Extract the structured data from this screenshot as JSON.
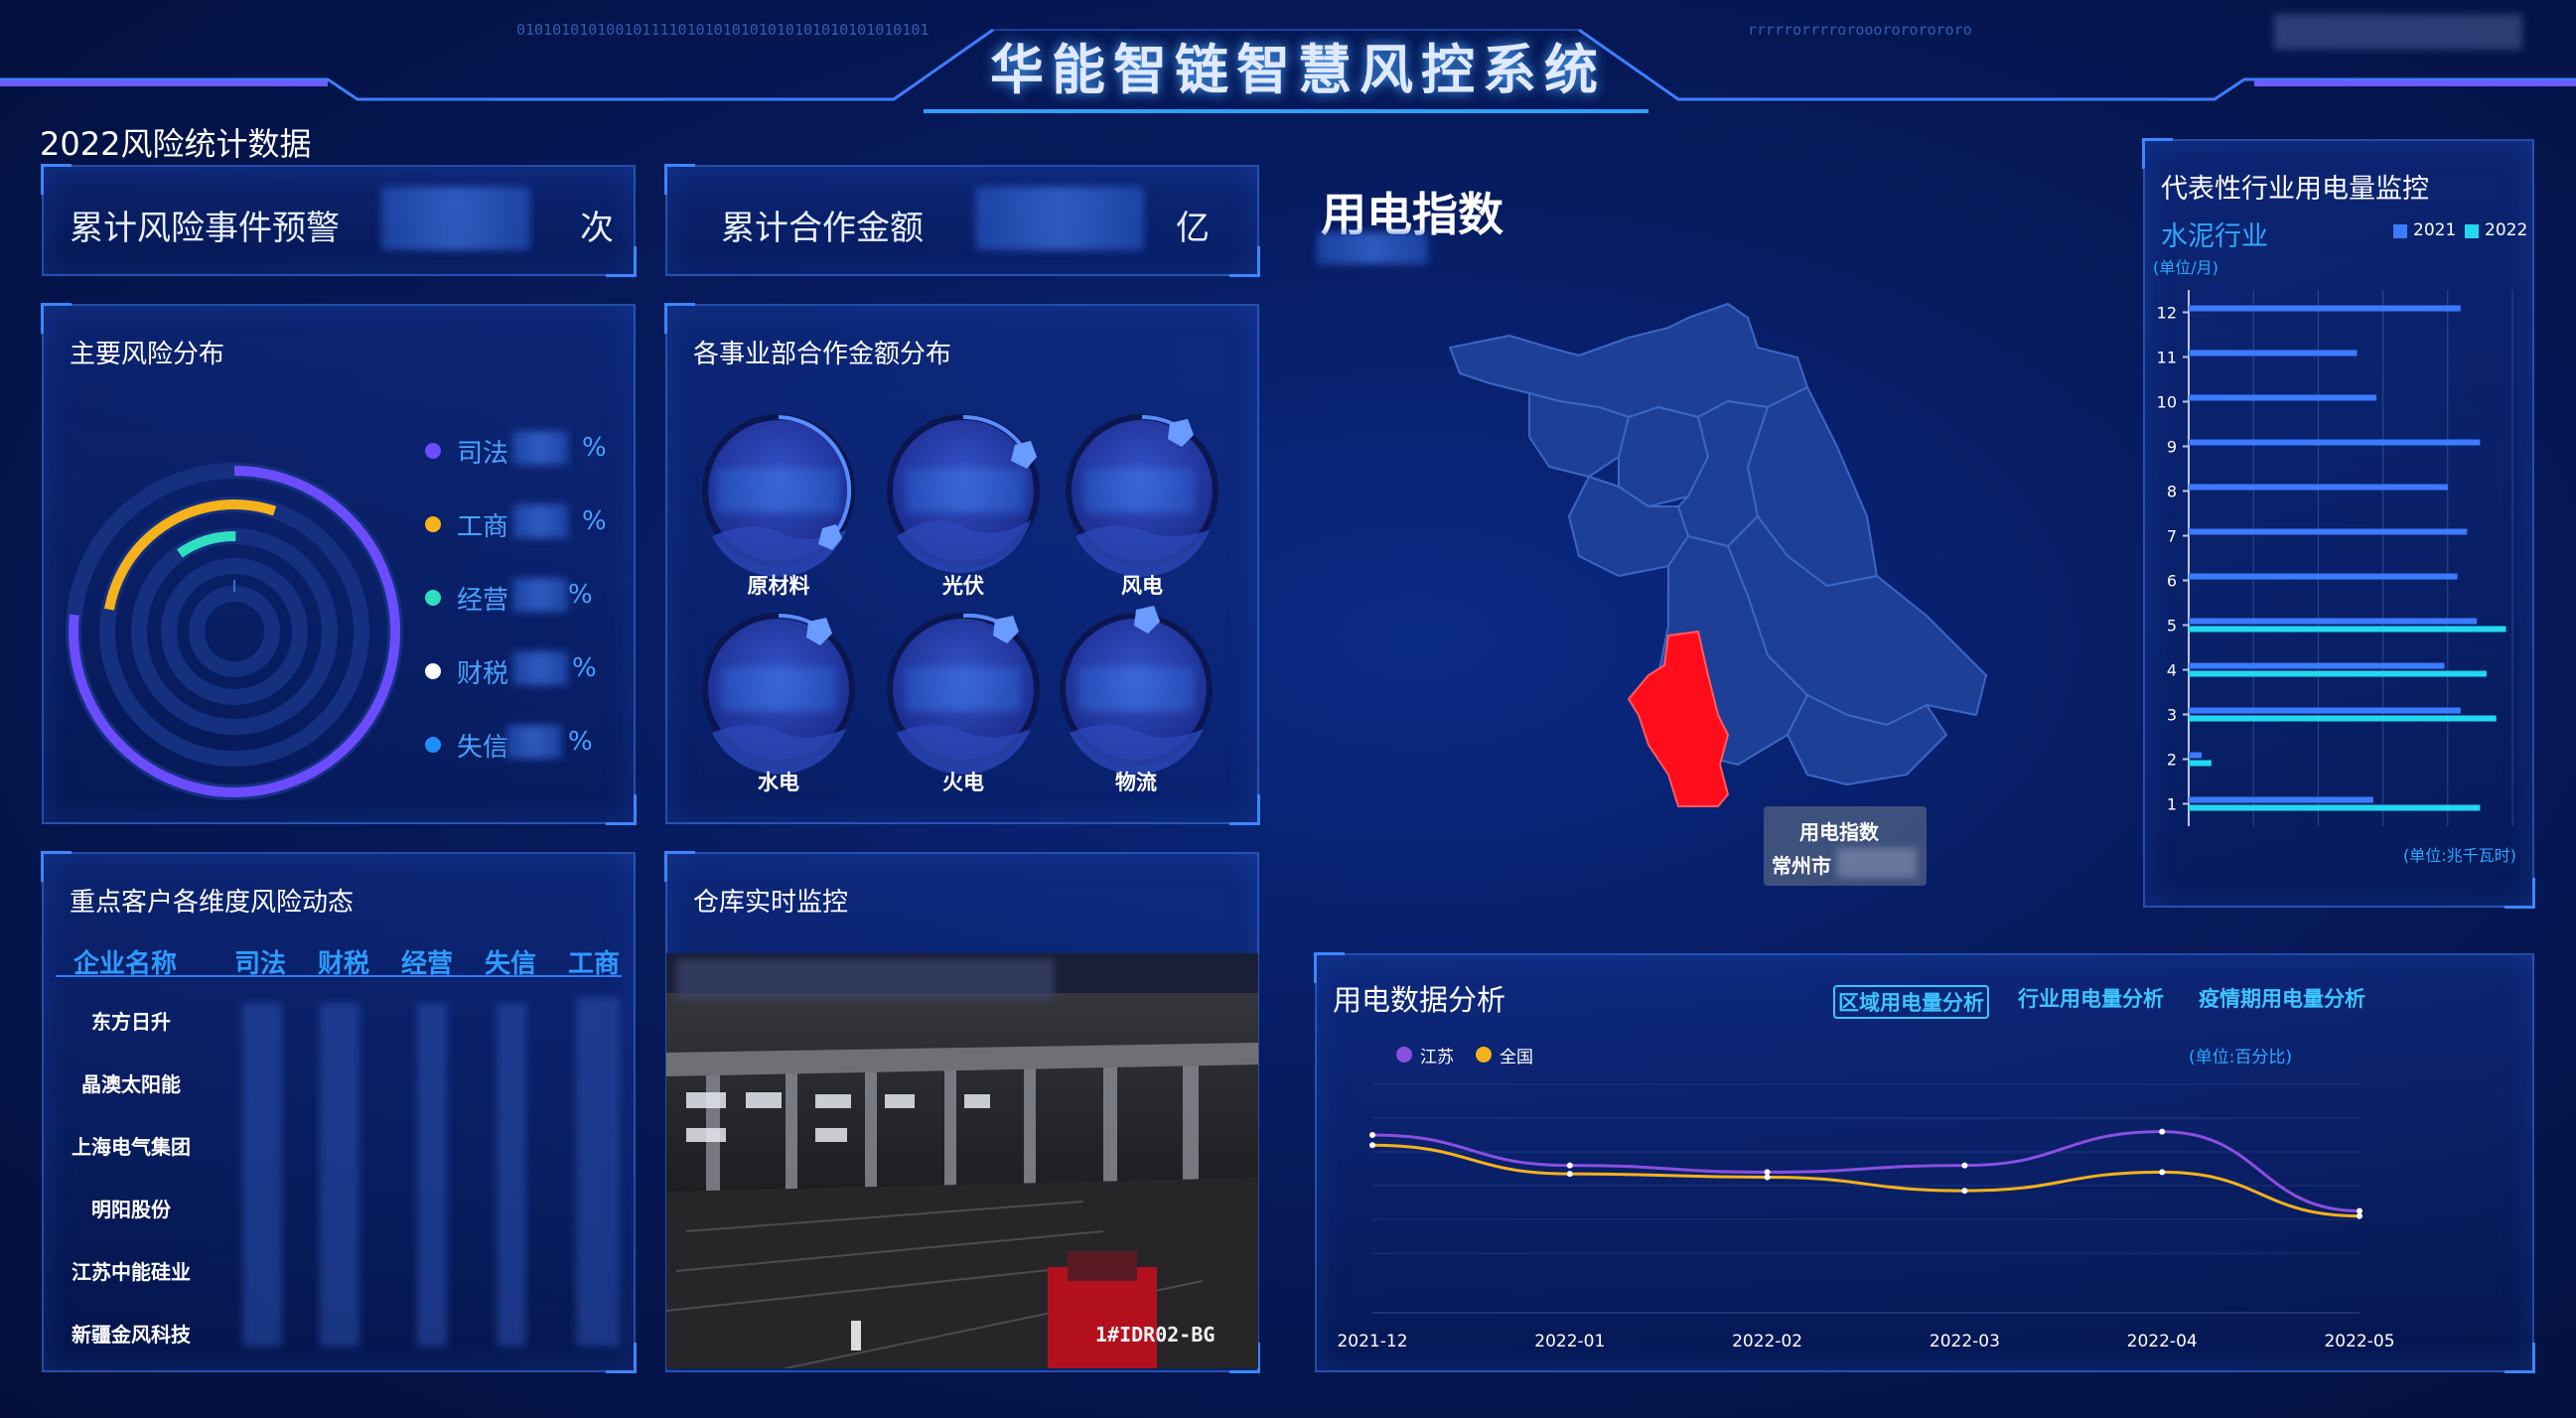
{
  "header": {
    "title": "华能智链智慧风控系统",
    "deco_binary_left": "0101010101001011110101010101010101010101010101",
    "deco_binary_right": "rrrrrorrrrorooorororororo"
  },
  "stats": {
    "section_title": "2022风险统计数据",
    "risk_events_label": "累计风险事件预警",
    "risk_events_unit": "次",
    "coop_amount_label": "累计合作金额",
    "coop_amount_unit": "亿"
  },
  "risk_distribution": {
    "title": "主要风险分布",
    "items": [
      {
        "label": "司法",
        "unit": "%",
        "color": "#6b4cff"
      },
      {
        "label": "工商",
        "unit": "%",
        "color": "#f5b21b"
      },
      {
        "label": "经营",
        "unit": "%",
        "color": "#2fe0c0"
      },
      {
        "label": "财税",
        "unit": "%",
        "color": "#ffffff"
      },
      {
        "label": "失信",
        "unit": "%",
        "color": "#1f8fff"
      }
    ]
  },
  "division_distribution": {
    "title": "各事业部合作金额分布",
    "bubbles": [
      "原材料",
      "光伏",
      "风电",
      "水电",
      "火电",
      "物流"
    ]
  },
  "customer_risk": {
    "title": "重点客户各维度风险动态",
    "columns": [
      "企业名称",
      "司法",
      "财税",
      "经营",
      "失信",
      "工商"
    ],
    "companies": [
      "东方日升",
      "晶澳太阳能",
      "上海电气集团",
      "明阳股份",
      "江苏中能硅业",
      "新疆金风科技"
    ]
  },
  "warehouse": {
    "title": "仓库实时监控",
    "camera_id": "1#IDR02-BG"
  },
  "power_index": {
    "title": "用电指数",
    "tooltip_title": "用电指数",
    "tooltip_city": "常州市"
  },
  "industry_monitor": {
    "title": "代表性行业用电量监控",
    "industry": "水泥行业",
    "unit_month": "(单位/月)",
    "unit_value": "(单位:兆千瓦时)",
    "legend": [
      {
        "name": "2021",
        "color": "#3b7bff"
      },
      {
        "name": "2022",
        "color": "#22d8f0"
      }
    ],
    "chart_data": {
      "type": "bar",
      "orientation": "horizontal",
      "categories": [
        "12",
        "11",
        "10",
        "9",
        "8",
        "7",
        "6",
        "5",
        "4",
        "3",
        "2",
        "1"
      ],
      "series": [
        {
          "name": "2021",
          "values": [
            84,
            52,
            58,
            90,
            80,
            86,
            83,
            89,
            79,
            84,
            4,
            57
          ]
        },
        {
          "name": "2022",
          "values": [
            null,
            null,
            null,
            null,
            null,
            null,
            null,
            98,
            92,
            95,
            7,
            90
          ]
        }
      ],
      "xlim": [
        0,
        100
      ]
    }
  },
  "power_analysis": {
    "title": "用电数据分析",
    "tabs": [
      "区域用电量分析",
      "行业用电量分析",
      "疫情期用电量分析"
    ],
    "unit": "(单位:百分比)",
    "legend": [
      {
        "name": "江苏",
        "color": "#8b4fe0"
      },
      {
        "name": "全国",
        "color": "#f5b21b"
      }
    ],
    "chart_data": {
      "type": "line",
      "x": [
        "2021-12",
        "2022-01",
        "2022-02",
        "2022-03",
        "2022-04",
        "2022-05"
      ],
      "series": [
        {
          "name": "江苏",
          "values": [
            70,
            52,
            48,
            52,
            72,
            25
          ]
        },
        {
          "name": "全国",
          "values": [
            64,
            47,
            45,
            37,
            48,
            22
          ]
        }
      ],
      "ylim": [
        0,
        100
      ]
    }
  }
}
